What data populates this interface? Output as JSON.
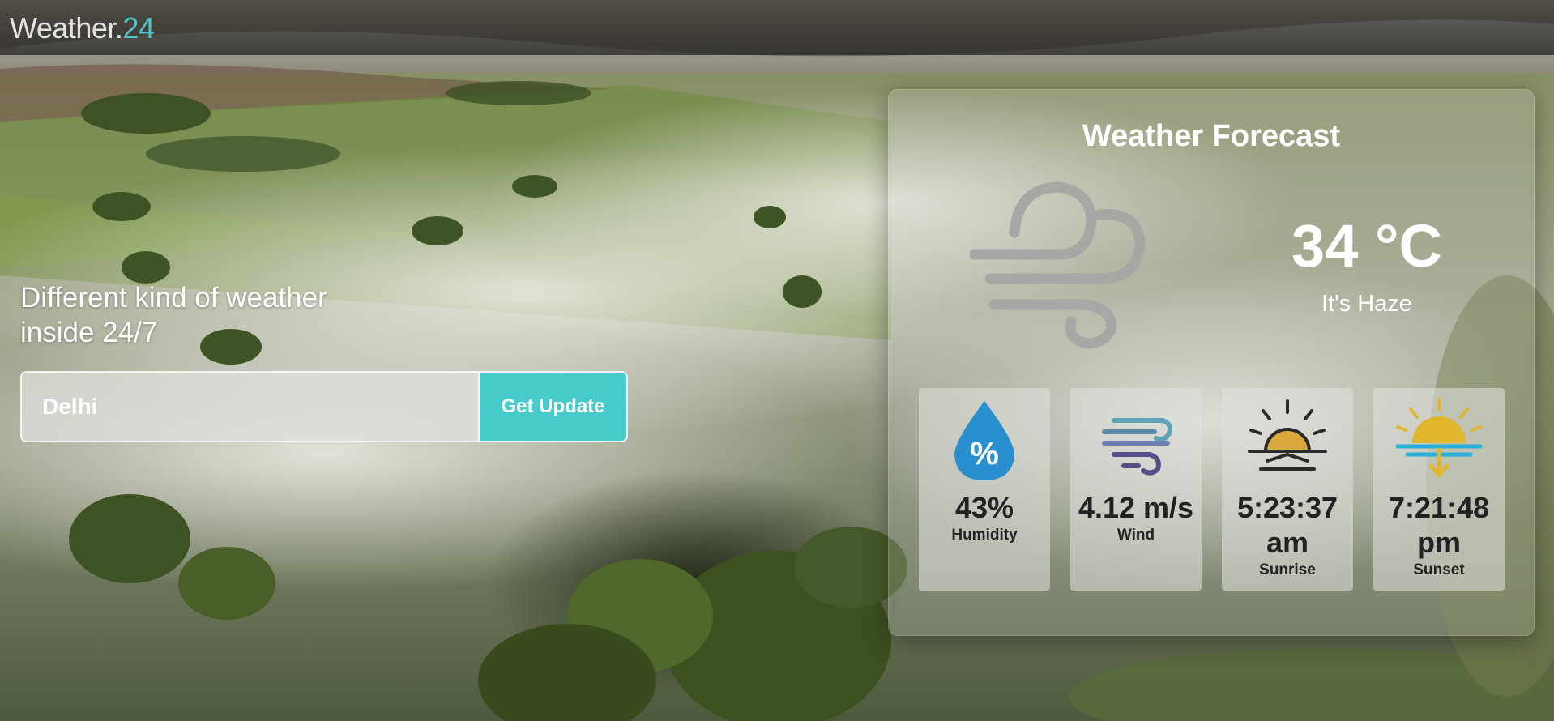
{
  "brand": {
    "name": "Weather.",
    "accent": "24",
    "accent_color": "#4fc6c9"
  },
  "hero": {
    "line1": "Different kind of weather",
    "line2": "inside 24/7"
  },
  "search": {
    "value": "Delhi",
    "button_label": "Get Update",
    "button_color": "#47cbca"
  },
  "forecast": {
    "title": "Weather Forecast",
    "icon": "wind-icon",
    "temperature": "34 °C",
    "condition": "It's Haze",
    "stats": [
      {
        "icon": "humidity-drop-icon",
        "value": "43%",
        "label": "Humidity"
      },
      {
        "icon": "wind-icon",
        "value": "4.12 m/s",
        "label": "Wind"
      },
      {
        "icon": "sunrise-icon",
        "value": "5:23:37 am",
        "label": "Sunrise"
      },
      {
        "icon": "sunset-icon",
        "value": "7:21:48 pm",
        "label": "Sunset"
      }
    ]
  }
}
